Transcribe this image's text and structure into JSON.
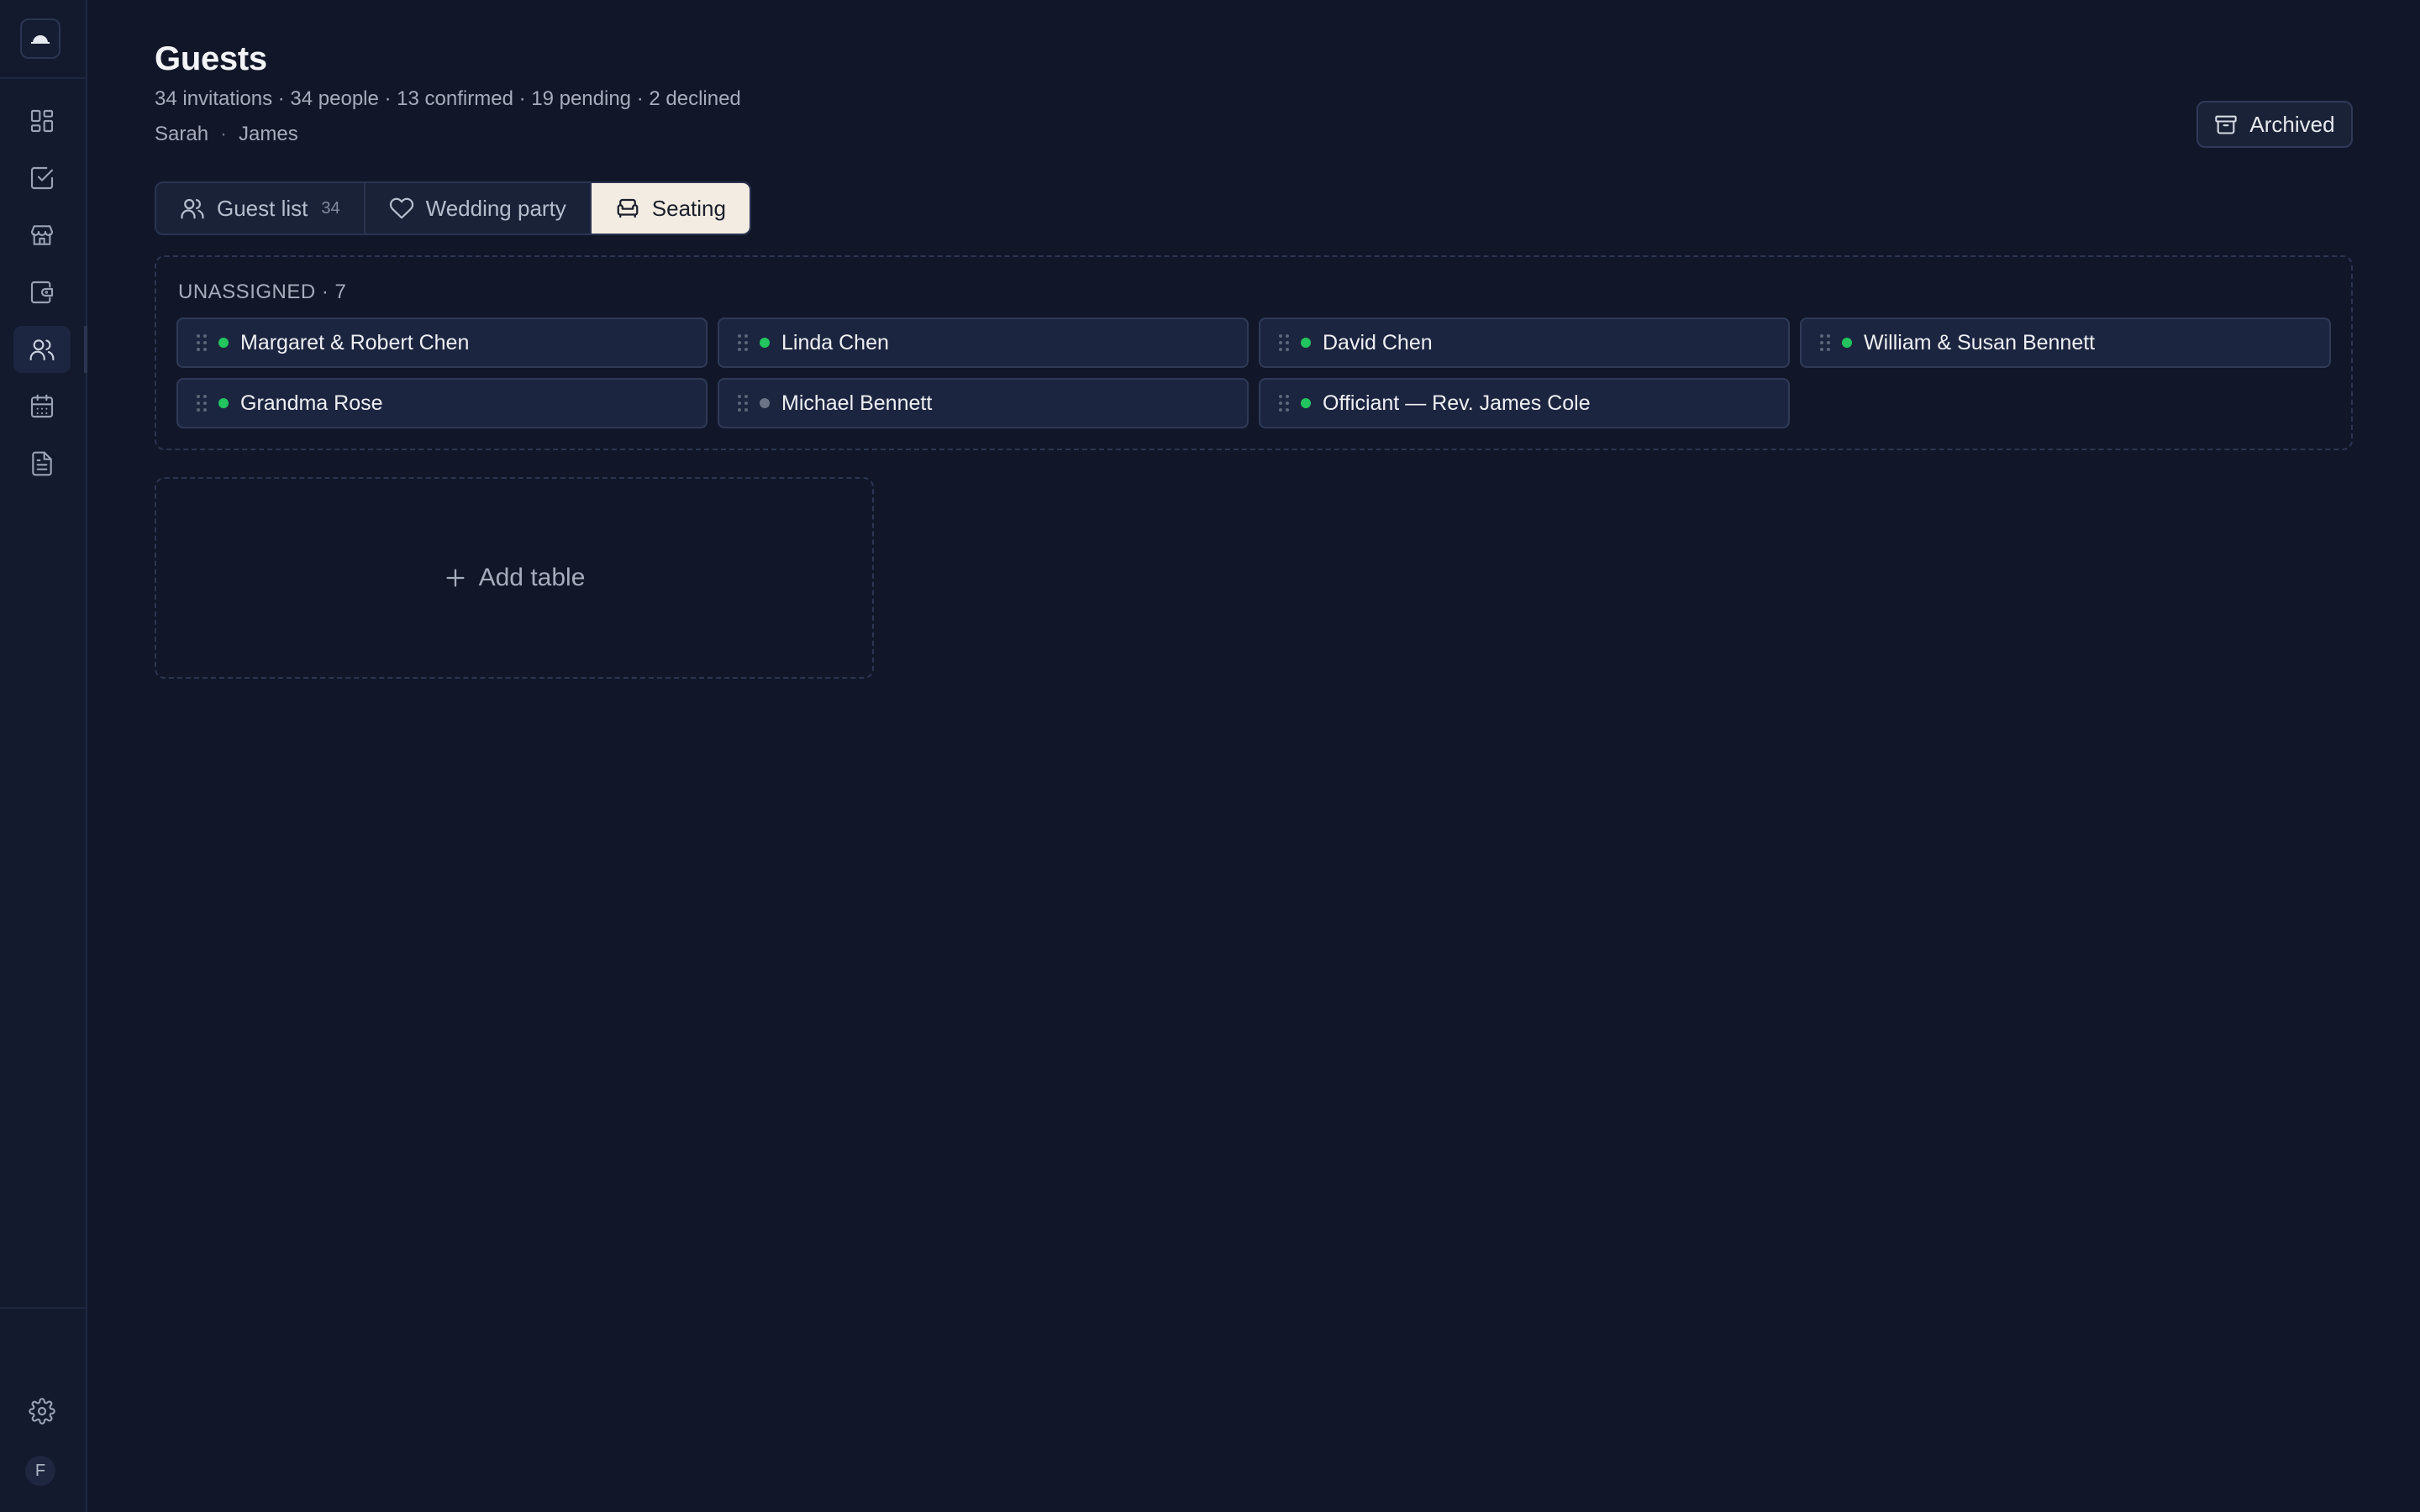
{
  "sidebar": {
    "logo_icon": "cloud-icon",
    "items": [
      {
        "name": "dashboard",
        "icon": "grid-icon",
        "active": false
      },
      {
        "name": "tasks",
        "icon": "checkbox-icon",
        "active": false
      },
      {
        "name": "vendors",
        "icon": "store-icon",
        "active": false
      },
      {
        "name": "budget",
        "icon": "wallet-icon",
        "active": false
      },
      {
        "name": "guests",
        "icon": "users-icon",
        "active": true
      },
      {
        "name": "calendar",
        "icon": "calendar-icon",
        "active": false
      },
      {
        "name": "documents",
        "icon": "document-icon",
        "active": false
      }
    ],
    "settings_icon": "gear-icon",
    "avatar_initial": "F"
  },
  "header": {
    "title": "Guests",
    "summary": "34 invitations · 34 people · 13 confirmed · 19 pending · 2 declined",
    "partner_1": "Sarah",
    "separator": "·",
    "partner_2": "James",
    "archived_label": "Archived"
  },
  "tabs": [
    {
      "label": "Guest list",
      "count": "34",
      "icon": "users-icon",
      "active": false
    },
    {
      "label": "Wedding party",
      "icon": "heart-icon",
      "active": false
    },
    {
      "label": "Seating",
      "icon": "armchair-icon",
      "active": true
    }
  ],
  "unassigned": {
    "label": "UNASSIGNED · 7",
    "guests": [
      {
        "name": "Margaret & Robert Chen",
        "status": "confirmed"
      },
      {
        "name": "Linda Chen",
        "status": "confirmed"
      },
      {
        "name": "David Chen",
        "status": "confirmed"
      },
      {
        "name": "William & Susan Bennett",
        "status": "confirmed"
      },
      {
        "name": "Grandma Rose",
        "status": "confirmed"
      },
      {
        "name": "Michael Bennett",
        "status": "pending"
      },
      {
        "name": "Officiant — Rev. James Cole",
        "status": "confirmed"
      }
    ]
  },
  "add_table_label": "Add table",
  "colors": {
    "background": "#111729",
    "sidebar": "#131a2e",
    "confirmed": "#22c55e",
    "pending": "#6b7386",
    "active_tab": "#f3ece2"
  }
}
